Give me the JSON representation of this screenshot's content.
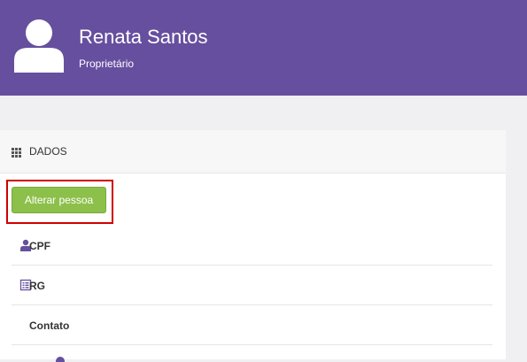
{
  "header": {
    "name": "Renata Santos",
    "role": "Proprietário"
  },
  "panel": {
    "title": "DADOS",
    "alter_button": "Alterar pessoa",
    "rows": [
      {
        "label": "CPF",
        "icon": "user-icon"
      },
      {
        "label": "RG",
        "icon": "id-card-icon"
      },
      {
        "label": "Contato",
        "icon": ""
      }
    ]
  },
  "colors": {
    "header_bg": "#664f9f",
    "button_bg": "#8cc04b",
    "highlight": "#d00000",
    "accent_icon": "#664f9f"
  }
}
